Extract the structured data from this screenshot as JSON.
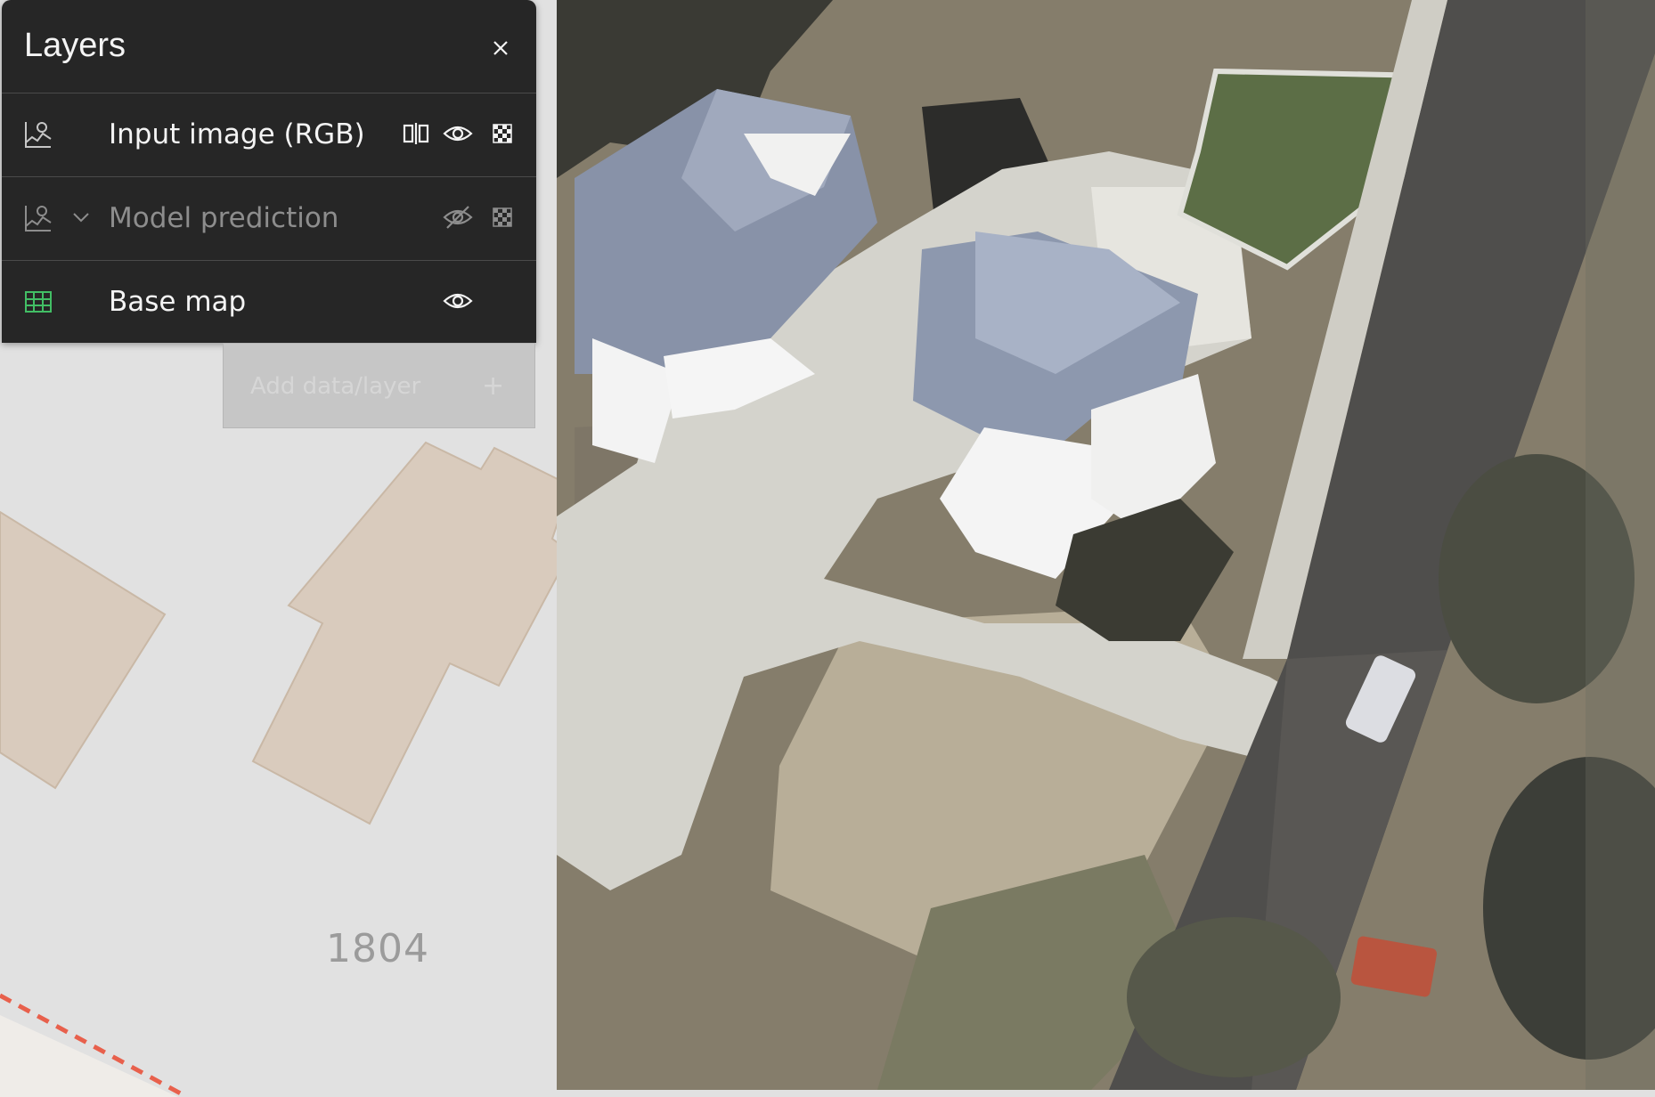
{
  "layers_panel": {
    "title": "Layers",
    "close_icon": "close-icon",
    "layers": [
      {
        "name": "Input image (RGB)",
        "type_icon": "raster-image-icon",
        "visible": true,
        "actions": [
          "compare-icon",
          "eye-icon",
          "opacity-icon"
        ]
      },
      {
        "name": "Model prediction",
        "type_icon": "raster-image-icon",
        "visible": false,
        "expandable": true,
        "actions": [
          "eye-off-icon",
          "opacity-icon"
        ]
      },
      {
        "name": "Base map",
        "type_icon": "map-icon",
        "icon_color": "#42be65",
        "visible": true,
        "actions": [
          "eye-icon"
        ]
      }
    ],
    "add_button": {
      "label": "Add data/layer",
      "icon": "plus-icon"
    }
  },
  "map": {
    "address_label": "1804",
    "colors": {
      "background": "#e1e1e1",
      "building": "#d9cbbd",
      "building_outline": "#c9b8a6",
      "road_dash": "#e8604c"
    }
  }
}
